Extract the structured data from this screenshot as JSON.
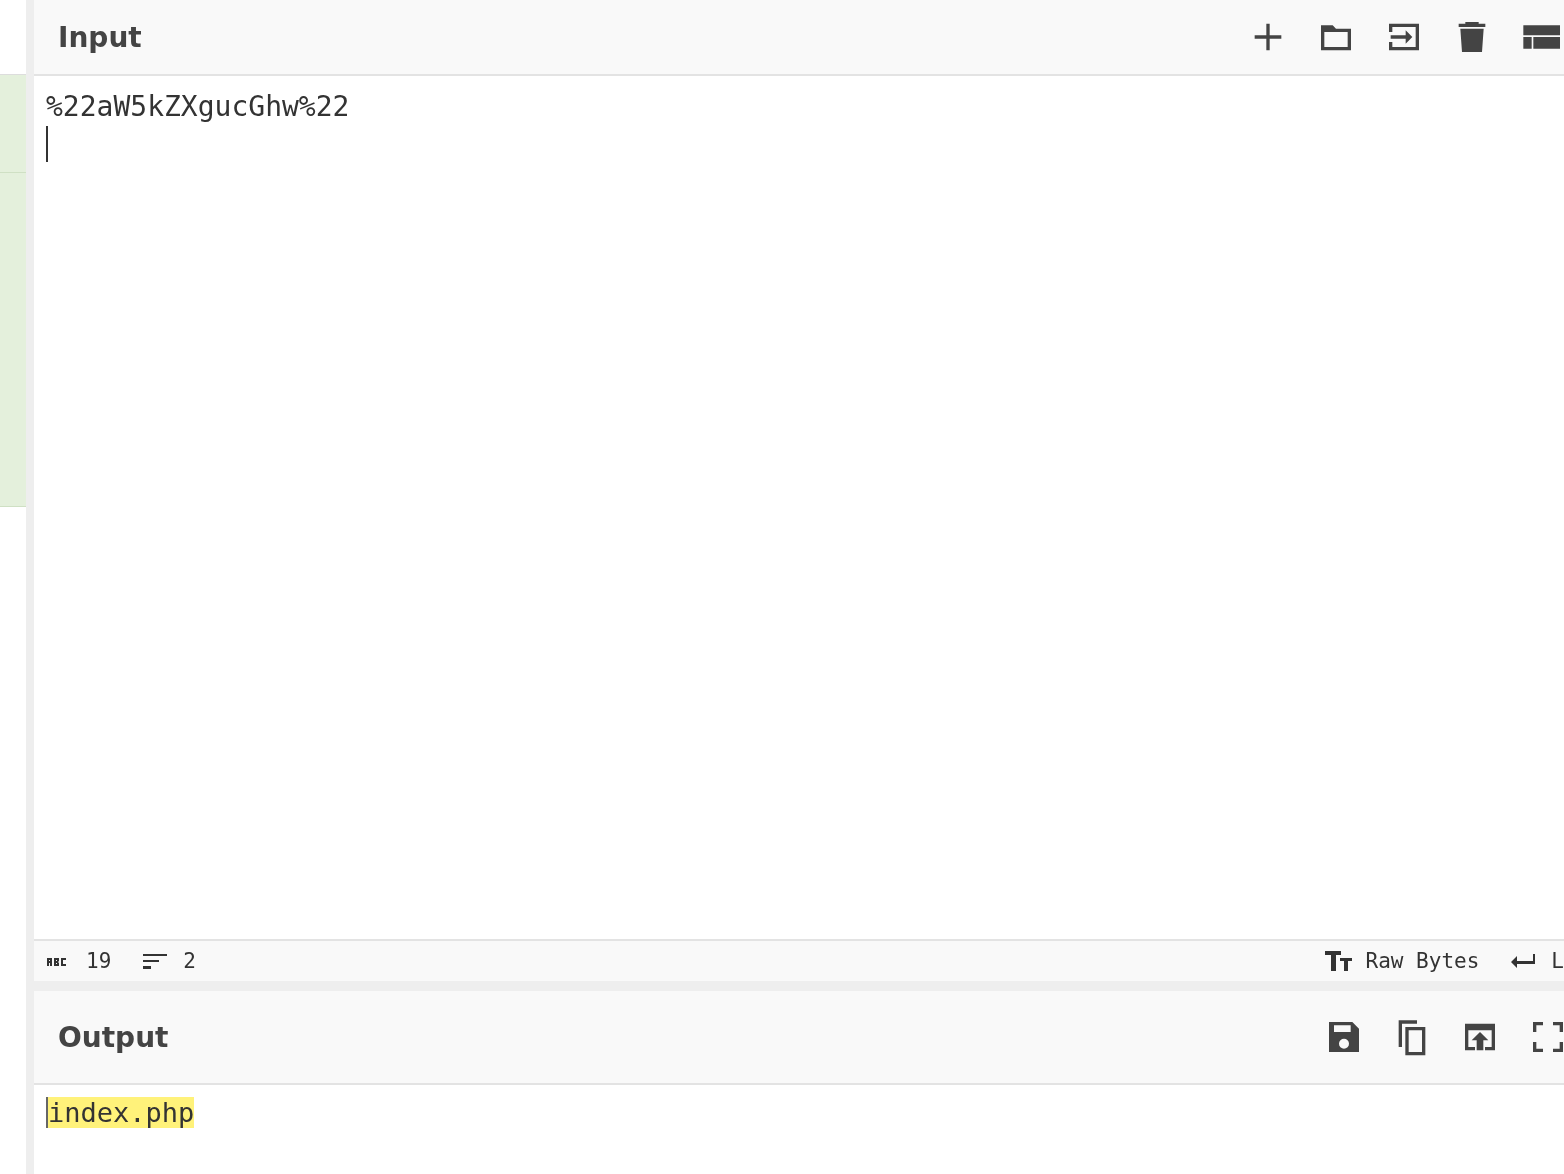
{
  "input": {
    "title": "Input",
    "text": "%22aW5kZXgucGhw%22"
  },
  "status_bar": {
    "characters": "19",
    "lines": "2",
    "encoding": "Raw Bytes",
    "line_ending": "L"
  },
  "output": {
    "title": "Output",
    "text": "index.php",
    "highlighted": true
  }
}
